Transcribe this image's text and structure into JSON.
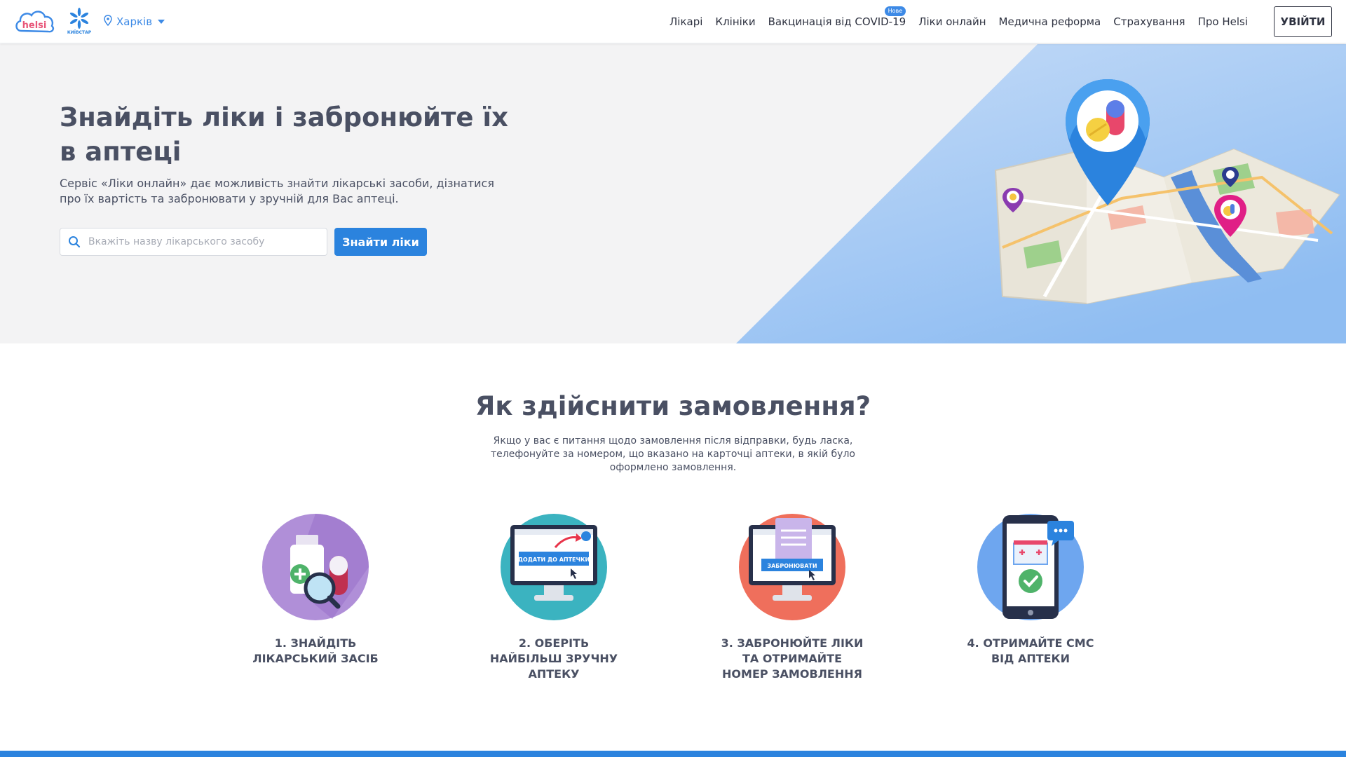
{
  "header": {
    "logo_text": "helsi",
    "partner_logo_text": "КИЇВСТАР",
    "city": "Харків",
    "nav": [
      {
        "label": "Лікарі"
      },
      {
        "label": "Клініки"
      },
      {
        "label": "Вакцинація від COVID-19",
        "badge": "Нове"
      },
      {
        "label": "Ліки онлайн"
      },
      {
        "label": "Медична реформа"
      },
      {
        "label": "Страхування"
      },
      {
        "label": "Про Helsi"
      }
    ],
    "login_label": "УВІЙТИ"
  },
  "hero": {
    "title": "Знайдіть ліки і забронюйте їх в аптеці",
    "description": "Сервіс «Ліки онлайн» дає можливість знайти лікарські засоби, дізнатися про їх вартість та забронювати у зручній для Вас аптеці.",
    "search_placeholder": "Вкажіть назву лікарського засобу",
    "search_value": "",
    "button_label": "Знайти ліки"
  },
  "how_to": {
    "title": "Як здійснити замовлення?",
    "subtitle": "Якщо у вас є питання щодо замовлення після відправки, будь ласка, телефонуйте за номером, що вказано на карточці аптеки, в якій було оформлено замовлення.",
    "steps": [
      {
        "line1": "1. ЗНАЙДІТЬ",
        "line2": "ЛІКАРСЬКИЙ ЗАСІБ",
        "line3": "",
        "color": "#b08fd8"
      },
      {
        "line1": "2. ОБЕРІТЬ",
        "line2": "НАЙБІЛЬШ ЗРУЧНУ",
        "line3": "АПТЕКУ",
        "color": "#3bb3c0",
        "screen_button": "ДОДАТИ ДО АПТЕЧКИ"
      },
      {
        "line1": "3. ЗАБРОНЮЙТЕ ЛІКИ",
        "line2": "ТА ОТРИМАЙТЕ",
        "line3": "НОМЕР ЗАМОВЛЕННЯ",
        "color": "#ef6f5c",
        "screen_button": "ЗАБРОНЮВАТИ"
      },
      {
        "line1": "4. ОТРИМАЙТЕ СМС",
        "line2": "ВІД АПТЕКИ",
        "line3": "",
        "color": "#6ea6ef"
      }
    ]
  },
  "colors": {
    "accent": "#2b83de",
    "text": "#4a5063",
    "hero_bg": "#f3f3f4"
  }
}
